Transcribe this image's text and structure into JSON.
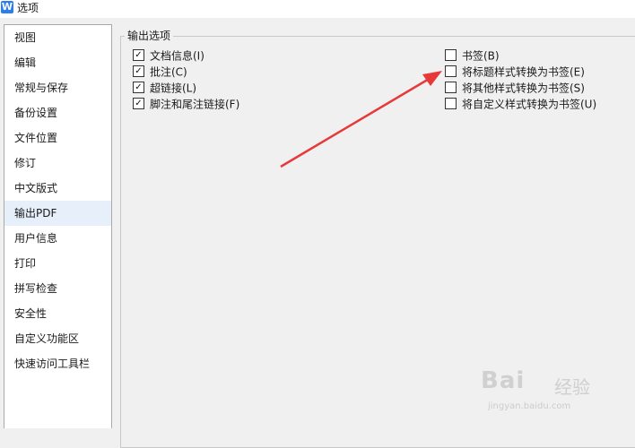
{
  "window": {
    "title": "选项",
    "app_icon_letter": "W",
    "app_icon_color": "#2b7ef0"
  },
  "sidebar": {
    "items": [
      {
        "label": "视图"
      },
      {
        "label": "编辑"
      },
      {
        "label": "常规与保存"
      },
      {
        "label": "备份设置"
      },
      {
        "label": "文件位置"
      },
      {
        "label": "修订"
      },
      {
        "label": "中文版式"
      },
      {
        "label": "输出PDF",
        "selected": true
      },
      {
        "label": "用户信息"
      },
      {
        "label": "打印"
      },
      {
        "label": "拼写检查"
      },
      {
        "label": "安全性"
      },
      {
        "label": "自定义功能区"
      },
      {
        "label": "快速访问工具栏"
      }
    ],
    "selected_bg": "#e6effa"
  },
  "output_options": {
    "title": "输出选项",
    "left": [
      {
        "label": "文档信息(I)",
        "checked": true
      },
      {
        "label": "批注(C)",
        "checked": true
      },
      {
        "label": "超链接(L)",
        "checked": true
      },
      {
        "label": "脚注和尾注链接(F)",
        "checked": true
      }
    ],
    "right": [
      {
        "label": "书签(B)",
        "checked": false
      },
      {
        "label": "将标题样式转换为书签(E)",
        "checked": false
      },
      {
        "label": "将其他样式转换为书签(S)",
        "checked": false
      },
      {
        "label": "将自定义样式转换为书签(U)",
        "checked": false
      }
    ]
  },
  "annotation": {
    "arrow_color": "#e8393a"
  },
  "watermark": {
    "brand": "Bai",
    "brand_suffix": "经验",
    "url": "jingyan.baidu.com"
  }
}
